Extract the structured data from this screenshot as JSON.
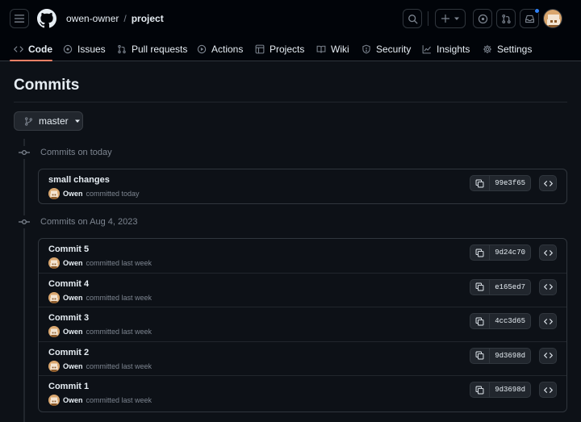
{
  "header": {
    "owner": "owen-owner",
    "separator": "/",
    "repo": "project"
  },
  "colors": {
    "background": "#0d1117",
    "header_bg": "#010409",
    "accent_underline": "#f78166",
    "notification_dot": "#2f81f7",
    "muted_text": "#7d8590"
  },
  "tabs": [
    {
      "label": "Code",
      "icon": "code-icon",
      "selected": true
    },
    {
      "label": "Issues",
      "icon": "issue-opened-icon"
    },
    {
      "label": "Pull requests",
      "icon": "git-pull-request-icon"
    },
    {
      "label": "Actions",
      "icon": "play-icon"
    },
    {
      "label": "Projects",
      "icon": "table-icon"
    },
    {
      "label": "Wiki",
      "icon": "book-icon"
    },
    {
      "label": "Security",
      "icon": "shield-icon"
    },
    {
      "label": "Insights",
      "icon": "graph-icon"
    },
    {
      "label": "Settings",
      "icon": "gear-icon"
    }
  ],
  "page": {
    "title": "Commits",
    "branch": "master"
  },
  "groups": [
    {
      "title": "Commits on today",
      "commits": [
        {
          "message": "small changes",
          "author": "Owen",
          "when": "committed today",
          "sha": "99e3f65"
        }
      ]
    },
    {
      "title": "Commits on Aug 4, 2023",
      "commits": [
        {
          "message": "Commit 5",
          "author": "Owen",
          "when": "committed last week",
          "sha": "9d24c70"
        },
        {
          "message": "Commit 4",
          "author": "Owen",
          "when": "committed last week",
          "sha": "e165ed7"
        },
        {
          "message": "Commit 3",
          "author": "Owen",
          "when": "committed last week",
          "sha": "4cc3d65"
        },
        {
          "message": "Commit 2",
          "author": "Owen",
          "when": "committed last week",
          "sha": "9d3698d"
        },
        {
          "message": "Commit 1",
          "author": "Owen",
          "when": "committed last week",
          "sha": "9d3698d"
        }
      ]
    }
  ]
}
